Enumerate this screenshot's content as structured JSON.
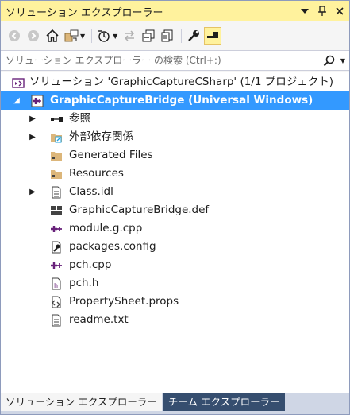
{
  "window": {
    "title": "ソリューション エクスプローラー"
  },
  "titlebar": {
    "dropdown_icon": "chevron-down-icon",
    "pin_icon": "pin-icon",
    "close_icon": "close-icon"
  },
  "toolbar": {
    "icons": [
      "back-icon",
      "forward-icon",
      "home-icon",
      "switch-views-icon",
      "pending-changes-filter-icon",
      "sync-icon",
      "collapse-all-icon",
      "copy-icon",
      "properties-icon",
      "preview-icon"
    ]
  },
  "search": {
    "placeholder": "ソリューション エクスプローラー の検索 (Ctrl+:)"
  },
  "tree": {
    "solution": "ソリューション 'GraphicCaptureCSharp' (1/1 プロジェクト)",
    "project": "GraphicCaptureBridge (Universal Windows)",
    "items": [
      {
        "label": "参照",
        "icon": "references-icon",
        "expandable": true
      },
      {
        "label": "外部依存関係",
        "icon": "external-dependencies-icon",
        "expandable": true
      },
      {
        "label": "Generated Files",
        "icon": "folder-icon",
        "expandable": false
      },
      {
        "label": "Resources",
        "icon": "folder-icon",
        "expandable": false
      },
      {
        "label": "Class.idl",
        "icon": "idl-file-icon",
        "expandable": true
      },
      {
        "label": "GraphicCaptureBridge.def",
        "icon": "def-file-icon",
        "expandable": false
      },
      {
        "label": "module.g.cpp",
        "icon": "cpp-file-icon",
        "expandable": false
      },
      {
        "label": "packages.config",
        "icon": "config-file-icon",
        "expandable": false
      },
      {
        "label": "pch.cpp",
        "icon": "cpp-file-icon",
        "expandable": false
      },
      {
        "label": "pch.h",
        "icon": "header-file-icon",
        "expandable": false
      },
      {
        "label": "PropertySheet.props",
        "icon": "props-file-icon",
        "expandable": false
      },
      {
        "label": "readme.txt",
        "icon": "text-file-icon",
        "expandable": false
      }
    ]
  },
  "bottom_tabs": [
    {
      "label": "ソリューション エクスプローラー",
      "active": true
    },
    {
      "label": "チーム エクスプローラー",
      "active": false
    }
  ],
  "colors": {
    "title_bg": "#fff29d",
    "selection_bg": "#3399ff",
    "tab_inactive_bg": "#364e6f",
    "cpp_icon": "#68217a"
  }
}
